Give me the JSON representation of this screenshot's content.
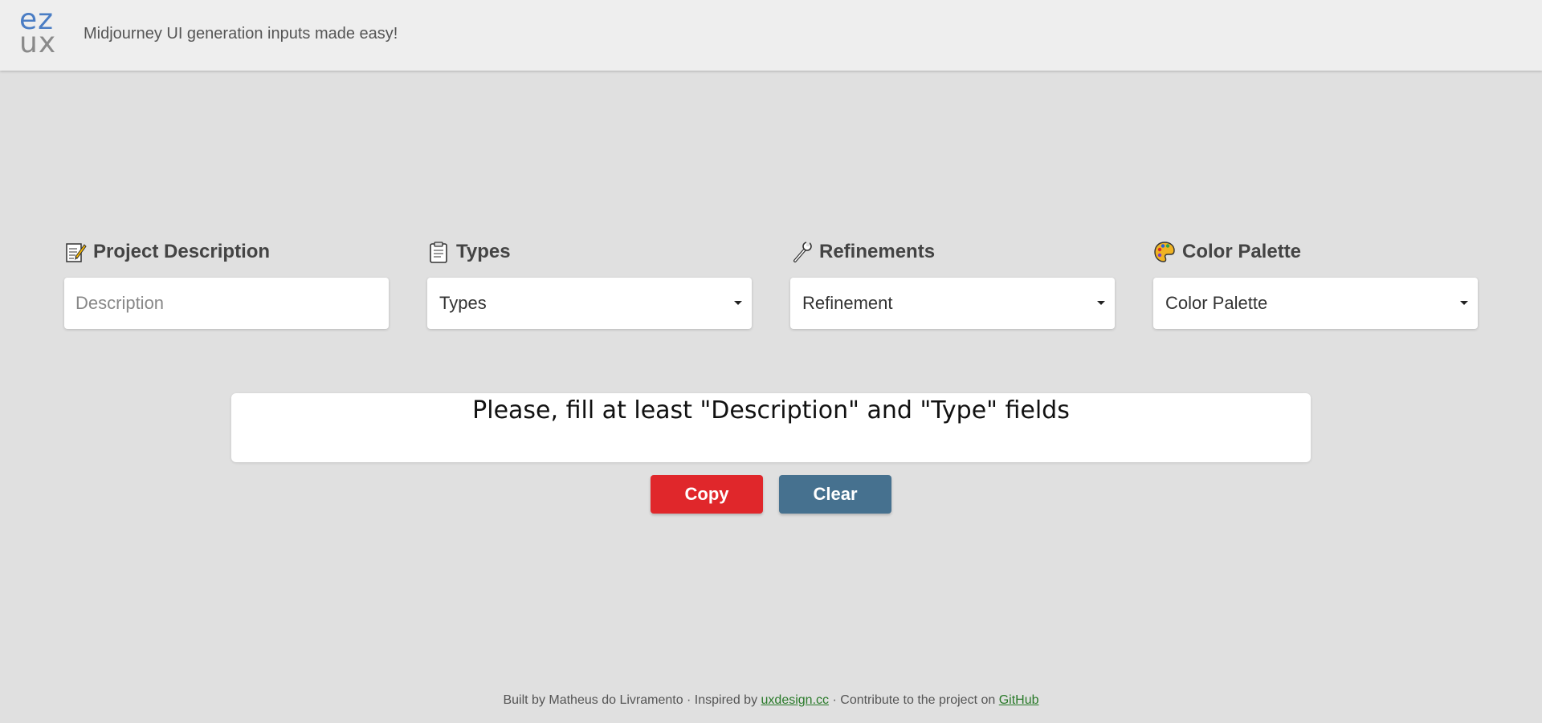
{
  "header": {
    "logo_top": "ez",
    "logo_bottom": "ux",
    "tagline": "Midjourney UI generation inputs made easy!"
  },
  "fields": {
    "description": {
      "label": "Project Description",
      "icon": "memo-icon",
      "placeholder": "Description"
    },
    "types": {
      "label": "Types",
      "icon": "clipboard-icon",
      "selected": "Types"
    },
    "refinements": {
      "label": "Refinements",
      "icon": "wrench-icon",
      "selected": "Refinement"
    },
    "palette": {
      "label": "Color Palette",
      "icon": "palette-icon",
      "selected": "Color Palette"
    }
  },
  "output": {
    "text": "Please, fill at least \"Description\" and \"Type\" fields"
  },
  "actions": {
    "copy_label": "Copy",
    "clear_label": "Clear",
    "copy_color": "#e0272b",
    "clear_color": "#46718f"
  },
  "footer": {
    "built_by": "Built by Matheus do Livramento · Inspired by",
    "inspired_link": "uxdesign.cc",
    "contribute": "· Contribute to the project on",
    "github_link": "GitHub"
  }
}
